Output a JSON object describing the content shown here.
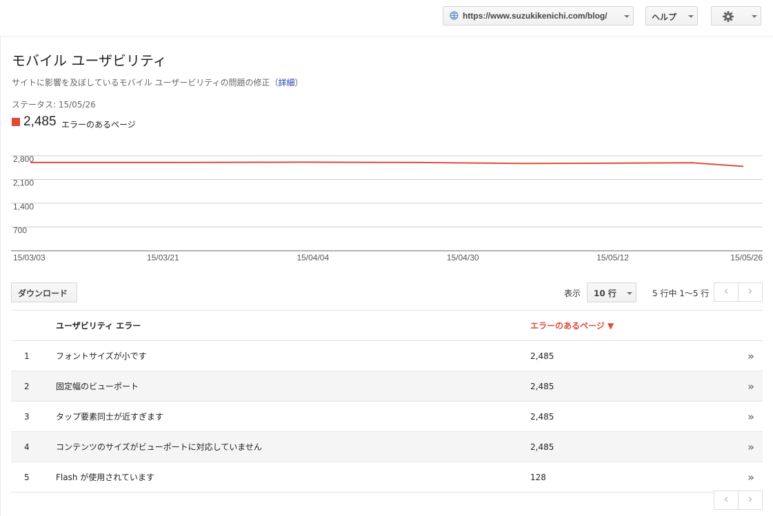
{
  "header": {
    "site_url": "https://www.suzukikenichi.com/blog/",
    "help_label": "ヘルプ"
  },
  "page": {
    "title": "モバイル ユーザビリティ",
    "subtitle": "サイトに影響を及ぼしているモバイル ユーザービリティの問題の修正（",
    "details_link": "詳細",
    "subtitle_close": "）",
    "status": "ステータス: 15/05/26"
  },
  "legend": {
    "value": "2,485",
    "label": "エラーのあるページ",
    "color": "#dd4b39"
  },
  "chart_data": {
    "type": "line",
    "y_ticks": [
      "2,800",
      "2,100",
      "1,400",
      "700"
    ],
    "x_ticks": [
      "15/03/03",
      "15/03/21",
      "15/04/04",
      "15/04/30",
      "15/05/12",
      "15/05/26"
    ],
    "ylim": [
      0,
      2800
    ],
    "grid": true,
    "series": [
      {
        "name": "エラーのあるページ",
        "color": "#dd4b39",
        "x": [
          "15/03/03",
          "15/03/21",
          "15/04/04",
          "15/04/18",
          "15/04/30",
          "15/05/12",
          "15/05/20",
          "15/05/26"
        ],
        "values": [
          2600,
          2600,
          2610,
          2600,
          2570,
          2580,
          2590,
          2485
        ]
      }
    ]
  },
  "toolbar": {
    "download_label": "ダウンロード",
    "show_label": "表示",
    "rows_value": "10 行",
    "range_label": "5 行中 1〜5 行"
  },
  "table": {
    "col_name": "ユーザビリティ エラー",
    "col_value": "エラーのあるページ ▼",
    "rows": [
      {
        "num": "1",
        "name": "フォントサイズが小です",
        "value": "2,485"
      },
      {
        "num": "2",
        "name": "固定幅のビューポート",
        "value": "2,485"
      },
      {
        "num": "3",
        "name": "タップ要素同士が近すぎます",
        "value": "2,485"
      },
      {
        "num": "4",
        "name": "コンテンツのサイズがビューポートに対応していません",
        "value": "2,485"
      },
      {
        "num": "5",
        "name": "Flash が使用されています",
        "value": "128"
      }
    ]
  }
}
